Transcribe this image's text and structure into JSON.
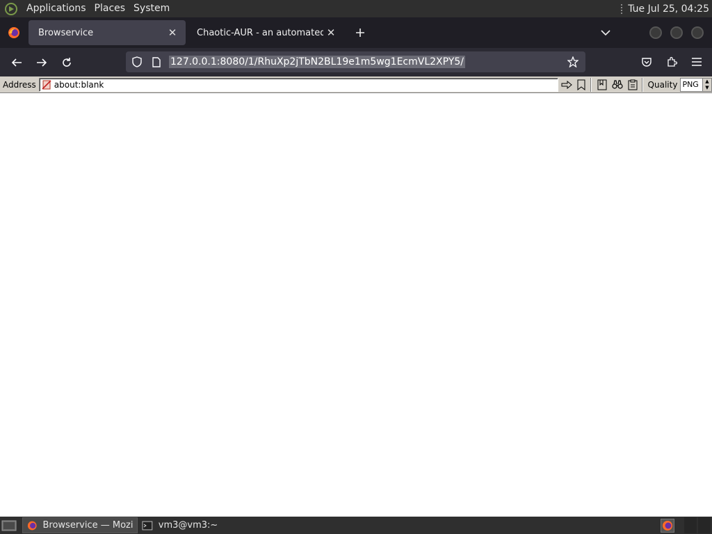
{
  "top_panel": {
    "menus": [
      "Applications",
      "Places",
      "System"
    ],
    "clock": "Tue Jul 25, 04:25"
  },
  "tabs": [
    {
      "title": "Browservice",
      "active": true
    },
    {
      "title": "Chaotic-AUR - an automated bu",
      "active": false
    }
  ],
  "navbar": {
    "url": "127.0.0.1:8080/1/RhuXp2jTbN2BL19e1m5wg1EcmVL2XPY5/"
  },
  "browservice": {
    "address_label": "Address",
    "address_value": "about:blank",
    "quality_label": "Quality",
    "quality_value": "PNG"
  },
  "taskbar": {
    "items": [
      {
        "label": "Browservice — Mozi…",
        "active": true
      },
      {
        "label": "vm3@vm3:~",
        "active": false
      }
    ]
  },
  "colors": {
    "panel": "#2f2f2f",
    "tabbar": "#1f1e25",
    "navbar": "#2b2a33",
    "urlbar": "#42414d",
    "bs_toolbar": "#d4d0c8"
  }
}
